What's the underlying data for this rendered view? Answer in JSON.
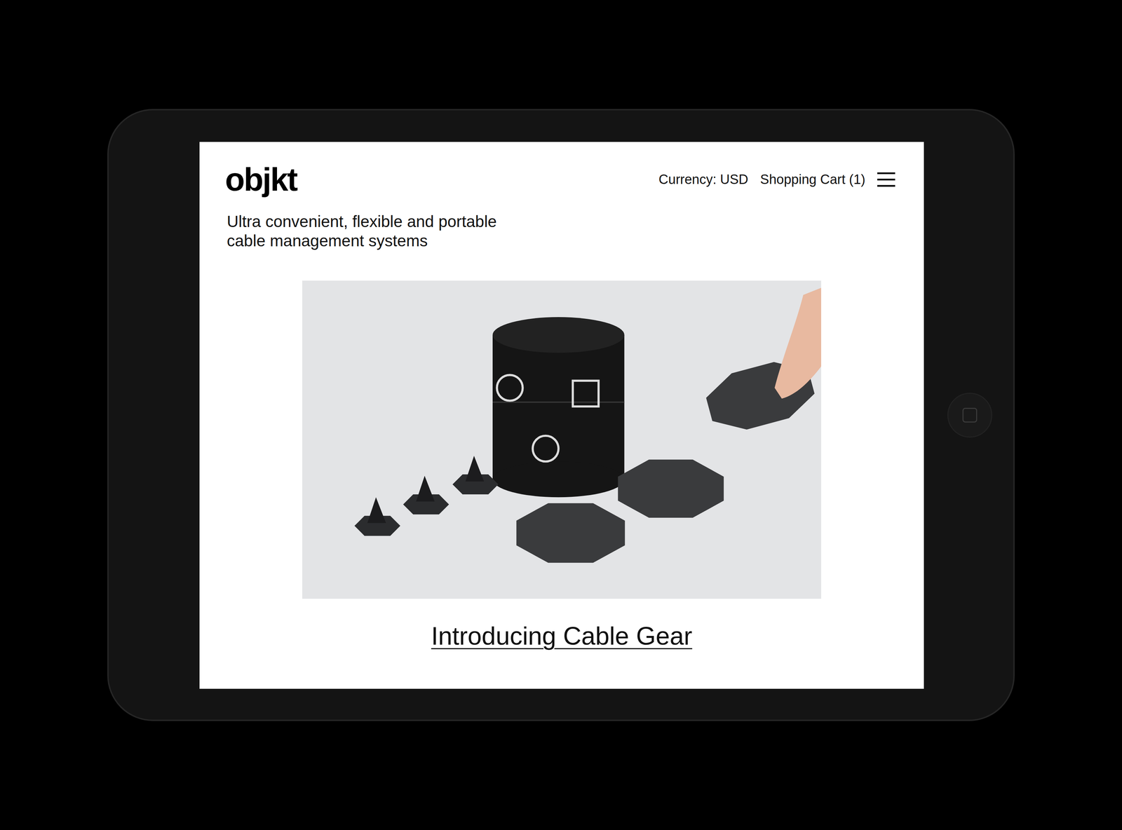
{
  "header": {
    "logo": "objkt",
    "currency": "Currency: USD",
    "cart": "Shopping Cart (1)"
  },
  "tagline": [
    "Ultra convenient, flexible and portable",
    "cable management systems"
  ],
  "feature": {
    "title": "Introducing Cable Gear"
  }
}
